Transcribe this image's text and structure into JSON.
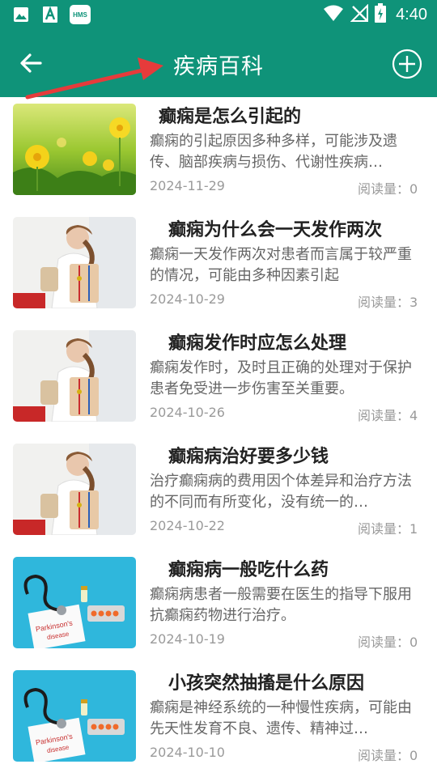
{
  "status_bar": {
    "time": "4:40",
    "icons_left": [
      "image-icon",
      "a-icon",
      "hms-icon"
    ],
    "hms_label": "HMS",
    "icons_right": [
      "wifi-icon",
      "no-signal-icon",
      "battery-charging-icon"
    ]
  },
  "app_bar": {
    "title": "疾病百科",
    "back_icon": "arrow-left-icon",
    "add_icon": "plus-circle-icon"
  },
  "articles": [
    {
      "title": "癫痫是怎么引起的",
      "desc": "癫痫的引起原因多种多样，可能涉及遗传、脑部疾病与损伤、代谢性疾病…",
      "date": "2024-11-29",
      "reads": "阅读量：0",
      "thumb": "dandelion"
    },
    {
      "title": "癫痫为什么会一天发作两次",
      "desc": "癫痫一天发作两次对患者而言属于较严重的情况，可能由多种因素引起",
      "date": "2024-10-29",
      "reads": "阅读量：3",
      "thumb": "doctor"
    },
    {
      "title": "癫痫发作时应怎么处理",
      "desc": "癫痫发作时，及时且正确的处理对于保护患者免受进一步伤害至关重要。",
      "date": "2024-10-26",
      "reads": "阅读量：4",
      "thumb": "doctor"
    },
    {
      "title": "癫痫病治好要多少钱",
      "desc": "治疗癫痫病的费用因个体差异和治疗方法的不同而有所变化，没有统一的…",
      "date": "2024-10-22",
      "reads": "阅读量：1",
      "thumb": "doctor"
    },
    {
      "title": "癫痫病一般吃什么药",
      "desc": "癫痫病患者一般需要在医生的指导下服用抗癫痫药物进行治疗。",
      "date": "2024-10-19",
      "reads": "阅读量：0",
      "thumb": "stethoscope",
      "thumb_text": "Parkinson's disease"
    },
    {
      "title": "小孩突然抽搐是什么原因",
      "desc": "癫痫是神经系统的一种慢性疾病，可能由先天性发育不良、遗传、精神过…",
      "date": "2024-10-10",
      "reads": "阅读量：0",
      "thumb": "stethoscope",
      "thumb_text": "Parkinson's disease"
    }
  ],
  "colors": {
    "primary": "#0f9379",
    "annotation_arrow": "#e63b3b"
  }
}
